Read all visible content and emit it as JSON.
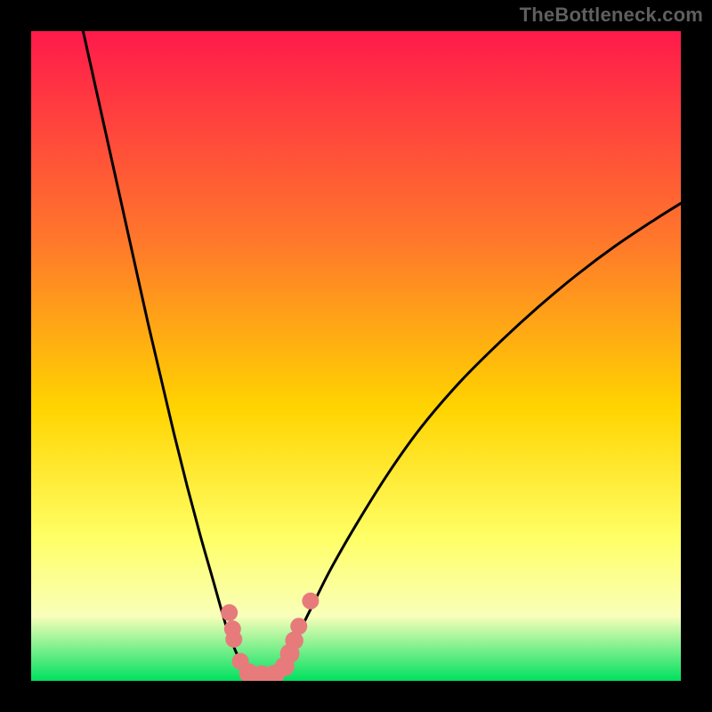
{
  "watermark": "TheBottleneck.com",
  "chart_data": {
    "type": "line",
    "title": "",
    "xlabel": "",
    "ylabel": "",
    "xlim": [
      0,
      100
    ],
    "ylim": [
      0,
      100
    ],
    "gradient_colors": {
      "top": "#ff1a4b",
      "upper_mid": "#ff7a2a",
      "mid": "#ffd400",
      "lower_mid": "#ffff66",
      "low": "#f9ffba",
      "bottom": "#00e060"
    },
    "series": [
      {
        "name": "left-curve",
        "x": [
          8,
          10,
          12,
          14,
          16,
          18,
          20,
          22,
          24,
          26,
          28,
          30,
          31.5,
          33
        ],
        "y": [
          100,
          91,
          82,
          73,
          64,
          55,
          46.5,
          38,
          30,
          22.5,
          15.5,
          8.5,
          4.5,
          1.5
        ]
      },
      {
        "name": "right-curve",
        "x": [
          38,
          40,
          43,
          46,
          50,
          55,
          60,
          66,
          72,
          78,
          84,
          90,
          96,
          100
        ],
        "y": [
          1.5,
          5,
          11,
          17,
          24,
          32,
          39,
          46,
          52,
          57.5,
          62.5,
          67,
          71,
          73.5
        ]
      },
      {
        "name": "valley-floor",
        "x": [
          33,
          35,
          37,
          38
        ],
        "y": [
          1.5,
          0.8,
          0.8,
          1.5
        ]
      }
    ],
    "markers": {
      "name": "data-points",
      "color": "#e77b7b",
      "points": [
        {
          "x": 30.5,
          "y": 10.5,
          "r": 1.3
        },
        {
          "x": 31.0,
          "y": 8.0,
          "r": 1.3
        },
        {
          "x": 31.2,
          "y": 6.4,
          "r": 1.3
        },
        {
          "x": 32.2,
          "y": 3.0,
          "r": 1.3
        },
        {
          "x": 33.5,
          "y": 1.2,
          "r": 1.5
        },
        {
          "x": 35.5,
          "y": 0.9,
          "r": 1.5
        },
        {
          "x": 37.5,
          "y": 1.0,
          "r": 1.5
        },
        {
          "x": 39.0,
          "y": 2.2,
          "r": 1.5
        },
        {
          "x": 39.8,
          "y": 4.2,
          "r": 1.5
        },
        {
          "x": 40.5,
          "y": 6.2,
          "r": 1.4
        },
        {
          "x": 41.2,
          "y": 8.4,
          "r": 1.3
        },
        {
          "x": 43.0,
          "y": 12.3,
          "r": 1.3
        }
      ]
    }
  }
}
